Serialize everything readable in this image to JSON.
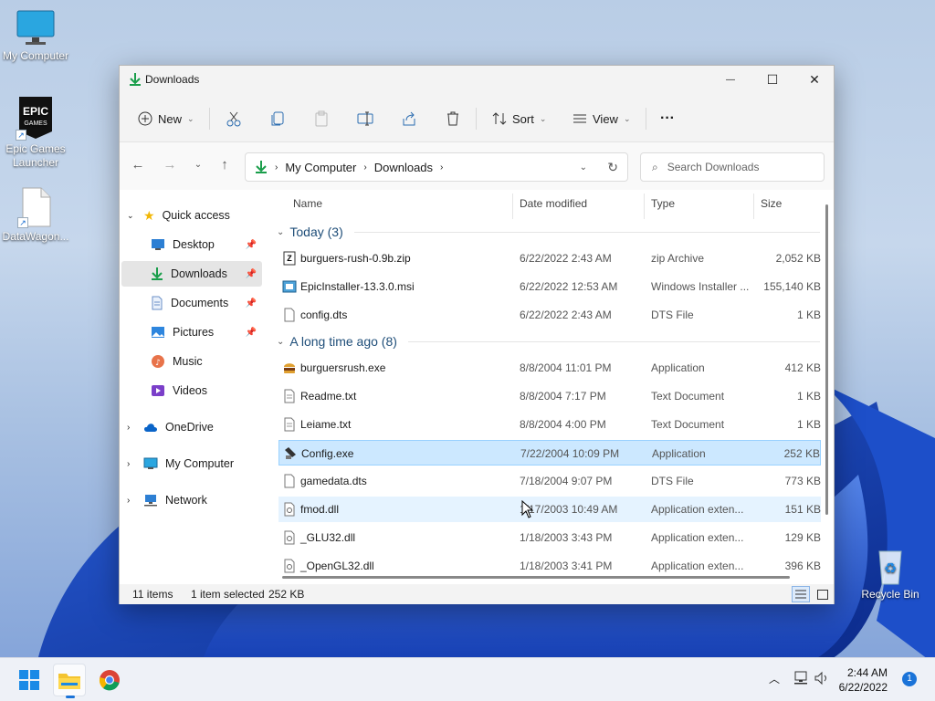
{
  "desktop": {
    "icons": [
      {
        "label": "My Computer",
        "icon": "monitor-icon"
      },
      {
        "label": "Epic Games Launcher",
        "icon": "epic-games-icon"
      },
      {
        "label": "DataWagon...",
        "icon": "file-icon"
      },
      {
        "label": "Recycle Bin",
        "icon": "recycle-bin-icon"
      }
    ]
  },
  "window": {
    "title": "Downloads",
    "controls": {
      "minimize": "—",
      "maximize": "☐",
      "close": "✕"
    }
  },
  "toolbar": {
    "new_label": "New",
    "sort_label": "Sort",
    "view_label": "View",
    "more_label": "···"
  },
  "address": {
    "crumbs": [
      "My Computer",
      "Downloads"
    ],
    "search_placeholder": "Search Downloads"
  },
  "nav": {
    "quick_access": "Quick access",
    "items": [
      {
        "label": "Desktop",
        "icon": "desktop-icon",
        "pinned": true
      },
      {
        "label": "Downloads",
        "icon": "download-icon",
        "pinned": true,
        "selected": true
      },
      {
        "label": "Documents",
        "icon": "documents-icon",
        "pinned": true
      },
      {
        "label": "Pictures",
        "icon": "pictures-icon",
        "pinned": true
      },
      {
        "label": "Music",
        "icon": "music-icon",
        "pinned": false
      },
      {
        "label": "Videos",
        "icon": "videos-icon",
        "pinned": false
      }
    ],
    "roots": [
      {
        "label": "OneDrive",
        "icon": "cloud-icon"
      },
      {
        "label": "My Computer",
        "icon": "monitor-icon"
      },
      {
        "label": "Network",
        "icon": "network-icon"
      }
    ]
  },
  "columns": {
    "name": "Name",
    "date": "Date modified",
    "type": "Type",
    "size": "Size"
  },
  "groups": [
    {
      "label": "Today (3)",
      "files": [
        {
          "name": "burguers-rush-0.9b.zip",
          "date": "6/22/2022 2:43 AM",
          "type": "zip Archive",
          "size": "2,052 KB",
          "icon": "zip-icon"
        },
        {
          "name": "EpicInstaller-13.3.0.msi",
          "date": "6/22/2022 12:53 AM",
          "type": "Windows Installer ...",
          "size": "155,140 KB",
          "icon": "installer-icon"
        },
        {
          "name": "config.dts",
          "date": "6/22/2022 2:43 AM",
          "type": "DTS File",
          "size": "1 KB",
          "icon": "file-icon"
        }
      ]
    },
    {
      "label": "A long time ago (8)",
      "files": [
        {
          "name": "burguersrush.exe",
          "date": "8/8/2004 11:01 PM",
          "type": "Application",
          "size": "412 KB",
          "icon": "burger-icon"
        },
        {
          "name": "Readme.txt",
          "date": "8/8/2004 7:17 PM",
          "type": "Text Document",
          "size": "1 KB",
          "icon": "text-file-icon"
        },
        {
          "name": "Leiame.txt",
          "date": "8/8/2004 4:00 PM",
          "type": "Text Document",
          "size": "1 KB",
          "icon": "text-file-icon"
        },
        {
          "name": "Config.exe",
          "date": "7/22/2004 10:09 PM",
          "type": "Application",
          "size": "252 KB",
          "icon": "config-app-icon",
          "selected": true
        },
        {
          "name": "gamedata.dts",
          "date": "7/18/2004 9:07 PM",
          "type": "DTS File",
          "size": "773 KB",
          "icon": "file-icon"
        },
        {
          "name": "fmod.dll",
          "date": "1/17/2003 10:49 AM",
          "type": "Application exten...",
          "size": "151 KB",
          "icon": "dll-icon",
          "hover": true
        },
        {
          "name": "_GLU32.dll",
          "date": "1/18/2003 3:43 PM",
          "type": "Application exten...",
          "size": "129 KB",
          "icon": "dll-icon"
        },
        {
          "name": "_OpenGL32.dll",
          "date": "1/18/2003 3:41 PM",
          "type": "Application exten...",
          "size": "396 KB",
          "icon": "dll-icon"
        }
      ]
    }
  ],
  "status": {
    "items": "11 items",
    "selected": "1 item selected",
    "size": "252 KB"
  },
  "taskbar": {
    "time": "2:44 AM",
    "date": "6/22/2022",
    "notifications": "1"
  }
}
